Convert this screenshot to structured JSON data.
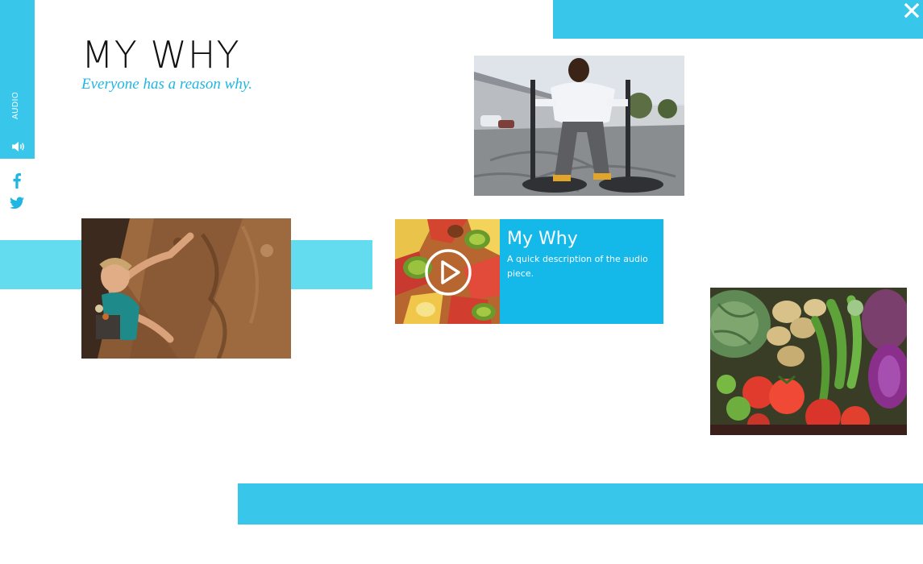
{
  "header": {
    "title": "MY WHY",
    "subtitle": "Everyone has a reason why."
  },
  "sidebar": {
    "audio_label": "AUDIO",
    "audio_icon": "speaker-icon",
    "share": [
      {
        "network": "facebook",
        "icon": "facebook-icon"
      },
      {
        "network": "twitter",
        "icon": "twitter-icon"
      }
    ]
  },
  "close_icon": "close-icon",
  "audio_card": {
    "title": "My Why",
    "description": "A quick description of the audio piece.",
    "play_icon": "play-icon"
  },
  "colors": {
    "accent": "#38c7ea",
    "accent_light": "#63dcef",
    "card": "#14b9ea",
    "subtitle": "#1fb6e4",
    "title": "#111111"
  }
}
